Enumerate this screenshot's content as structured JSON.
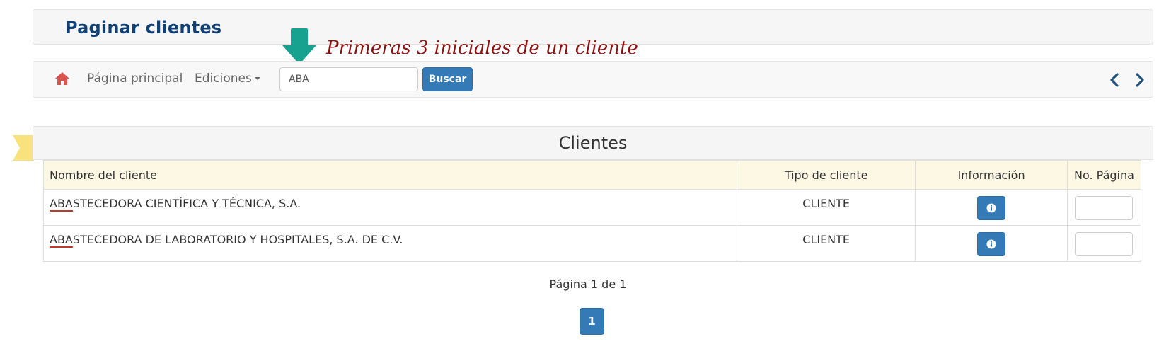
{
  "header": {
    "title": "Paginar clientes"
  },
  "annotation": {
    "text": "Primeras 3 iniciales de un cliente",
    "arrow_color": "#17a18f",
    "text_color": "#8b1010"
  },
  "navbar": {
    "home_icon": "home-icon",
    "home_icon_color": "#d9534f",
    "main_page_label": "Página principal",
    "editions_label": "Ediciones",
    "search": {
      "value": "ABA",
      "placeholder": ""
    },
    "search_button_label": "Buscar",
    "prev_icon": "chevron-left-icon",
    "next_icon": "chevron-right-icon",
    "accent": "#337ab7"
  },
  "panel": {
    "title": "Clientes"
  },
  "table": {
    "columns": [
      "Nombre del cliente",
      "Tipo de cliente",
      "Información",
      "No. Página"
    ],
    "rows": [
      {
        "initials": "ABA",
        "rest": "STECEDORA CIENTÍFICA Y TÉCNICA, S.A.",
        "type": "CLIENTE",
        "info_icon": "info-icon",
        "page_value": ""
      },
      {
        "initials": "ABA",
        "rest": "STECEDORA DE LABORATORIO Y HOSPITALES, S.A. DE C.V.",
        "type": "CLIENTE",
        "info_icon": "info-icon",
        "page_value": ""
      }
    ],
    "header_bg": "#fcf8e3"
  },
  "pagination": {
    "status": "Página 1 de 1",
    "current_page": "1"
  }
}
